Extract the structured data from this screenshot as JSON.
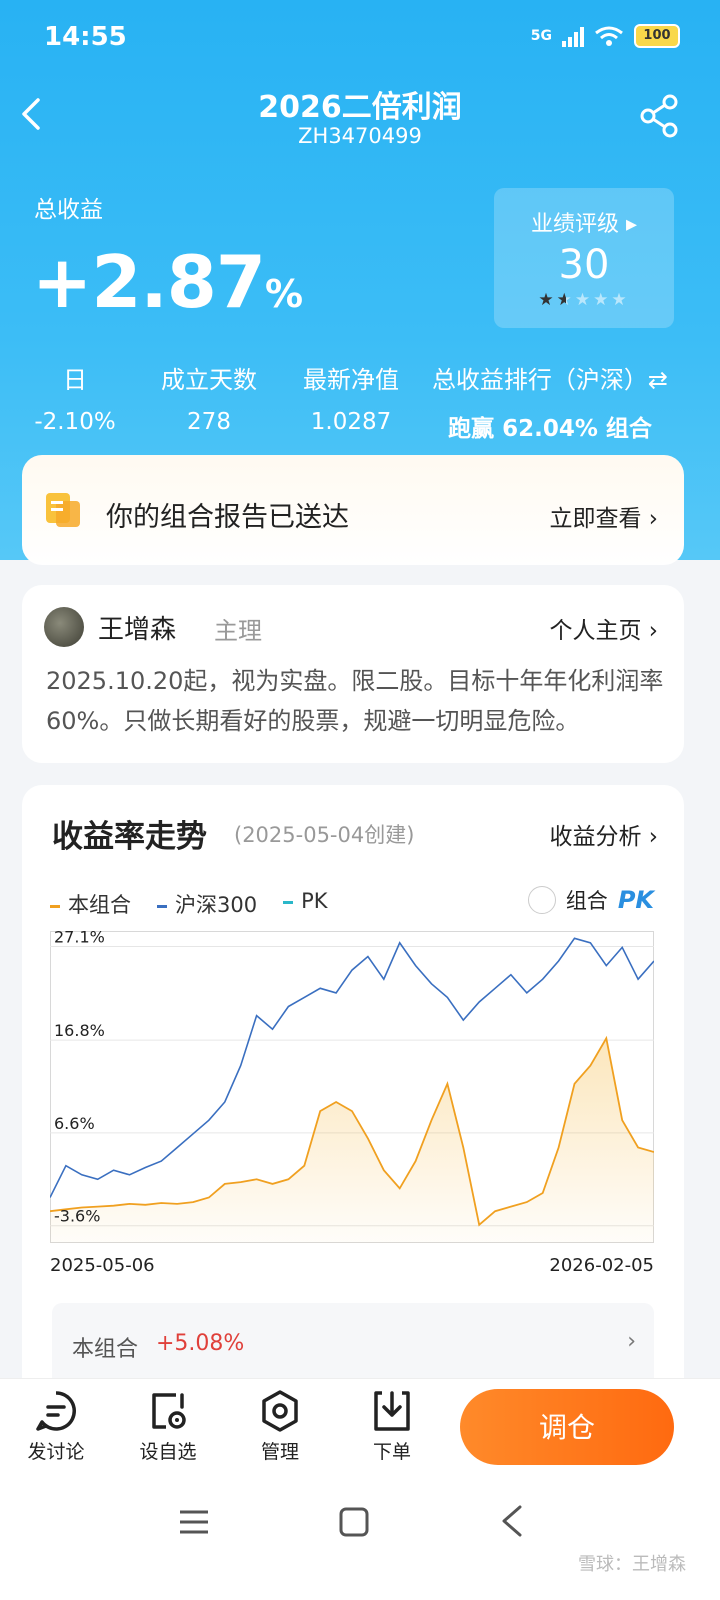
{
  "status": {
    "time": "14:55",
    "network": "5G",
    "battery": "100"
  },
  "nav": {
    "title": "2026二倍利润",
    "subtitle": "ZH3470499"
  },
  "summary": {
    "total_label": "总收益",
    "total_value": "+2.87",
    "total_unit": "%"
  },
  "rating": {
    "label": "业绩评级 ▸",
    "value": "30",
    "stars_filled": 1.5,
    "stars_total": 5
  },
  "stats": [
    {
      "label": "日",
      "value": "-2.10%"
    },
    {
      "label": "成立天数",
      "value": "278"
    },
    {
      "label": "最新净值",
      "value": "1.0287"
    },
    {
      "label": "总收益排行（沪深）⇄",
      "value": "跑赢 62.04% 组合"
    }
  ],
  "report": {
    "text": "你的组合报告已送达",
    "link": "立即查看 ›"
  },
  "manager": {
    "name": "王增森",
    "role": "主理",
    "link": "个人主页 ›",
    "description": "2025.10.20起，视为实盘。限二股。目标十年年化利润率60%。只做长期看好的股票，规避一切明显危险。"
  },
  "chart_section": {
    "title": "收益率走势",
    "created": "(2025-05-04创建)",
    "link": "收益分析 ›",
    "pk_label": "组合",
    "pk_logo": "PK"
  },
  "legend": [
    {
      "name": "本组合",
      "color": "#f0a020"
    },
    {
      "name": "沪深300",
      "color": "#3a6fc0"
    },
    {
      "name": "PK",
      "color": "#2ab7c9"
    }
  ],
  "chart_data": {
    "type": "line",
    "x_start": "2025-05-06",
    "x_end": "2026-02-05",
    "y_ticks": [
      "27.1%",
      "16.8%",
      "6.6%",
      "-3.6%"
    ],
    "y_tick_values": [
      27.1,
      16.8,
      6.6,
      -3.6
    ],
    "ylim": [
      -5.5,
      28.8
    ],
    "series": [
      {
        "name": "沪深300",
        "color": "#3a6fc0",
        "values": [
          -0.5,
          3.0,
          2.0,
          1.5,
          2.5,
          2.0,
          2.8,
          3.5,
          5.0,
          6.5,
          8.0,
          10.0,
          14.0,
          19.5,
          18.0,
          20.5,
          21.5,
          22.5,
          22.0,
          24.5,
          26.0,
          23.5,
          27.5,
          25.0,
          23.0,
          21.5,
          19.0,
          21.0,
          22.5,
          24.0,
          22.0,
          23.5,
          25.5,
          28.0,
          27.5,
          25.0,
          27.0,
          23.5,
          25.5
        ]
      },
      {
        "name": "本组合",
        "color": "#f0a020",
        "values": [
          -2.0,
          -1.8,
          -1.6,
          -1.5,
          -1.4,
          -1.2,
          -1.3,
          -1.1,
          -1.2,
          -1.0,
          -0.5,
          1.0,
          1.2,
          1.5,
          1.0,
          1.5,
          3.0,
          9.0,
          10.0,
          9.0,
          6.0,
          2.5,
          0.5,
          3.5,
          8.0,
          12.0,
          5.0,
          -3.5,
          -2.0,
          -1.5,
          -1.0,
          0.0,
          5.0,
          12.0,
          14.0,
          17.0,
          8.0,
          5.0,
          4.5
        ]
      }
    ]
  },
  "performance": {
    "label": "本组合",
    "value": "+5.08%"
  },
  "bottom_tabs": [
    {
      "label": "发讨论",
      "icon": "chat-icon"
    },
    {
      "label": "设自选",
      "icon": "star-gear-icon"
    },
    {
      "label": "管理",
      "icon": "hexagon-gear-icon"
    },
    {
      "label": "下单",
      "icon": "download-box-icon"
    }
  ],
  "primary_action": "调仓",
  "watermark": "雪球：王增森"
}
